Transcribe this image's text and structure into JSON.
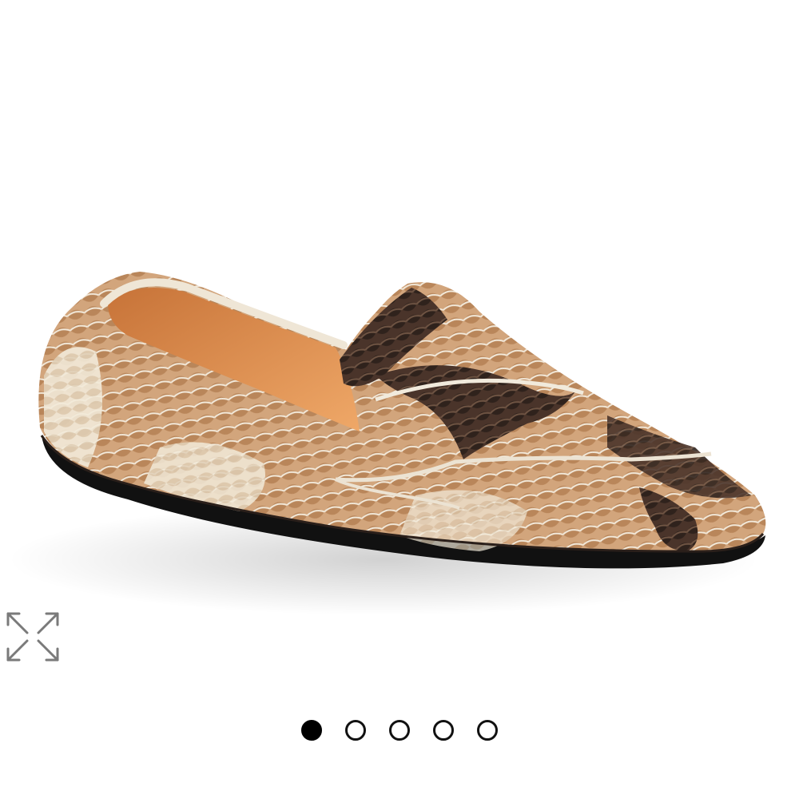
{
  "gallery": {
    "image": {
      "subject": "snakeskin-pointed-toe-loafer",
      "colors": {
        "background": "#ffffff",
        "snake_light": "#efe6d6",
        "snake_tan": "#c99a6e",
        "snake_brown": "#8a5a37",
        "snake_dark": "#3a2a22",
        "lining": "#d98a4a",
        "sole": "#111111"
      }
    },
    "expand_icon": "expand-arrows-icon",
    "pagination": {
      "total": 5,
      "active_index": 0,
      "active_color": "#000000",
      "inactive_color": "#ffffff"
    }
  }
}
